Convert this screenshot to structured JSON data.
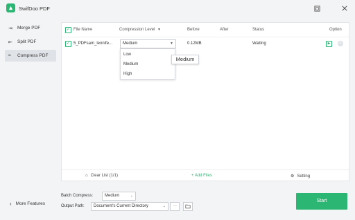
{
  "app": {
    "title": "SwifDoo PDF"
  },
  "window_controls": {
    "icons": [
      "fullscreen-icon",
      "close-icon"
    ]
  },
  "sidebar": {
    "items": [
      {
        "label": "Merge PDF",
        "icon": "merge-icon"
      },
      {
        "label": "Split PDF",
        "icon": "split-icon"
      },
      {
        "label": "Compress PDF",
        "icon": "compress-icon",
        "active": true
      }
    ],
    "more_label": "More Features"
  },
  "table": {
    "columns": [
      "File Name",
      "Compression Level",
      "Before",
      "After",
      "Status",
      "Option"
    ],
    "rows": [
      {
        "file_name": "5_PDFsam_lennife...",
        "compression_level": "Medium",
        "before": "0.12MB",
        "after": "",
        "status": "Waiting"
      }
    ]
  },
  "dropdown": {
    "options": [
      "Low",
      "Medium",
      "High"
    ]
  },
  "tooltip": {
    "text": "Medium"
  },
  "panel_footer": {
    "clear_label": "Clear List (1/1)",
    "add_label": "+ Add Files",
    "setting_label": "Setting"
  },
  "bottom": {
    "batch_label": "Batch Compress:",
    "batch_value": "Medium",
    "path_label": "Output Path:",
    "path_value": "Document's Current Directory",
    "more_dots": "···",
    "start_label": "Start"
  },
  "colors": {
    "accent": "#2bb673",
    "active_nav": "#dfe2e6"
  }
}
